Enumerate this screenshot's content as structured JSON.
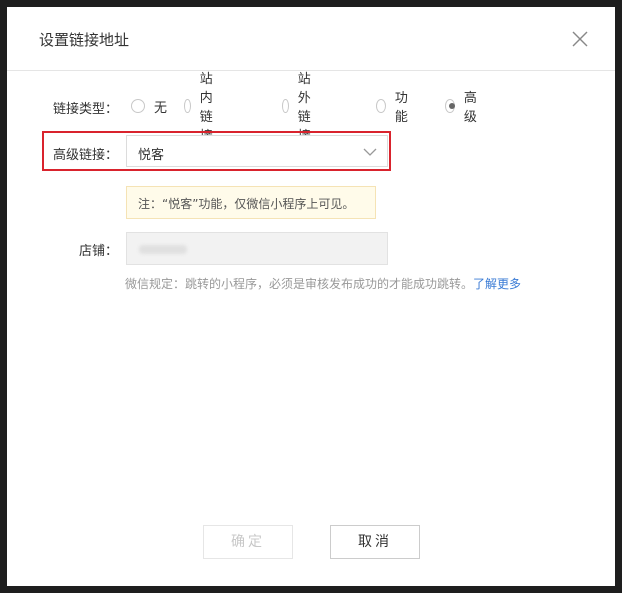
{
  "dialog": {
    "title": "设置链接地址"
  },
  "link_type": {
    "label": "链接类型：",
    "options": [
      "无",
      "站内链接",
      "站外链接",
      "功能",
      "高级"
    ],
    "selected": "高级"
  },
  "advanced_link": {
    "label": "高级链接：",
    "value": "悦客"
  },
  "notice": {
    "text": "注：“悦客”功能，仅微信小程序上可见。"
  },
  "shop": {
    "label": "店铺："
  },
  "rule": {
    "text": "微信规定：跳转的小程序，必须是审核发布成功的才能成功跳转。",
    "link": "了解更多"
  },
  "buttons": {
    "ok": "确定",
    "cancel": "取消"
  },
  "colors": {
    "highlight": "#d9232d",
    "link": "#3a7bd5",
    "notice_bg": "#fffbea"
  }
}
